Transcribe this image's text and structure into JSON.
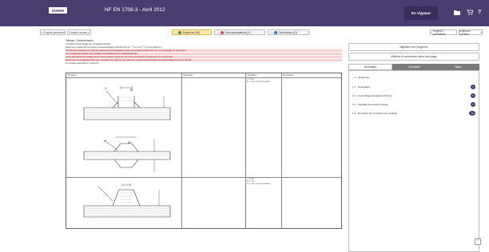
{
  "header": {
    "badge": "NORME",
    "title": "NF EN 1708-3 - Avril 2012",
    "status": "En Vigueur",
    "icons": [
      "folder-icon",
      "cart-icon",
      "help-icon"
    ]
  },
  "nav": {
    "prev_chapter": "Chapitre précédent",
    "next_chapter": "Chapitre suivant",
    "prev_req": "Exigence précédente",
    "next_req": "Exigence suivante"
  },
  "tabs": [
    {
      "label": "Exigences (38)",
      "dot": "green"
    },
    {
      "label": "Recommandations (2)",
      "dot": "red"
    },
    {
      "label": "Permissions (11)",
      "dot": "blue"
    }
  ],
  "doc": {
    "caption": "Tableau 2 Bordurements",
    "lines": [
      "2   Soudure d'assemblage aux tubulages/cylindres",
      "     Observer en regard de conception pour/assemblage conformément au ** C.1 et au ** C.2 de la Tableau 1",
      "Un essai de conception ou notes de calculs pour le tubulage/le cylindre de longueur réduite selon les normes/projets de conception",
      "ou montage/l'assemblage par soudage sera appliqué pour le tubulage/cylindre",
      "Si les paramètres de soudage de la soudure restant conformes à la norme, le fabricant d'équipement de soudure aux",
      "dimensions du tubulage/cylindre pour la soudure sur l'élément de référence correspondant/tubulage pour l'assemblage et pour les détails",
      "du tubulage assemblé en produit fini."
    ],
    "columns": [
      "N° Figure",
      "Application",
      "Conditions",
      "Remarques"
    ],
    "row1_conditions": "t ≤ 5 mm\nf1 ≥ t   voir 4.2.4 et au tableau",
    "row2_conditions": "t ≤ 5 mm\nf2 ≥ t mm\nf1 ≥ t   voir 4.2.4 et au tableau",
    "labels": [
      "V",
      "M",
      "V",
      "M"
    ]
  },
  "panel": {
    "report_btn": "Signaler une exigence",
    "toggle_btn": "Afficher le sommaire dans une page",
    "tabs": [
      "Sommaire",
      "Normatifs",
      "Tâges"
    ],
    "toc": [
      {
        "label": "1 - Exigences",
        "count": ""
      },
      {
        "label": "1.1 - Généralités",
        "count": "3"
      },
      {
        "label": "1.2 - Assemblage tubulages/cylindres",
        "count": "5"
      },
      {
        "label": "1.3 - Soudage des parois piquées",
        "count": "3"
      },
      {
        "label": "1.4 - Exemples de conception de soudage",
        "count": "12"
      }
    ]
  },
  "colors": {
    "header_bg": "#4a3c6e",
    "red_highlight": "#f8d2d2",
    "active_tab": "#fde9a8"
  }
}
